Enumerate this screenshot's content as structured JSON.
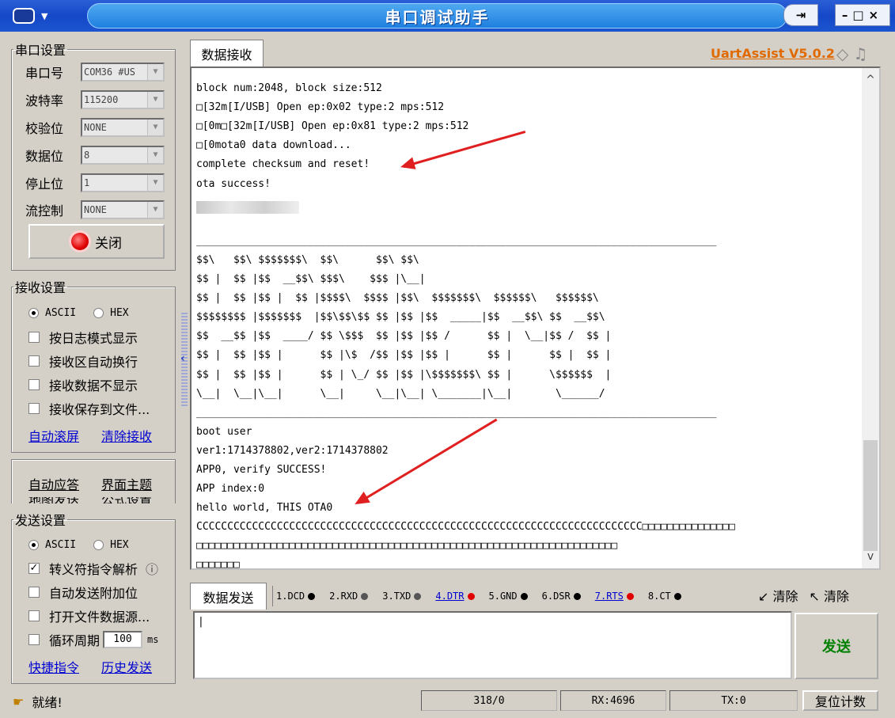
{
  "window": {
    "title": "串口调试助手"
  },
  "serial": {
    "legend": "串口设置",
    "port_label": "串口号",
    "port_value": "COM36 #US",
    "baud_label": "波特率",
    "baud_value": "115200",
    "parity_label": "校验位",
    "parity_value": "NONE",
    "databits_label": "数据位",
    "databits_value": "8",
    "stopbits_label": "停止位",
    "stopbits_value": "1",
    "flow_label": "流控制",
    "flow_value": "NONE",
    "close_label": "关闭"
  },
  "receive_settings": {
    "legend": "接收设置",
    "ascii": "ASCII",
    "hex": "HEX",
    "log_mode": "按日志模式显示",
    "auto_wrap": "接收区自动换行",
    "hide_data": "接收数据不显示",
    "save_file": "接收保存到文件...",
    "auto_scroll": "自动滚屏",
    "clear_recv": "清除接收"
  },
  "extra": {
    "auto_reply": "自动应答",
    "ui_theme": "界面主题",
    "cut1": "地图发送",
    "cut2": "公式设置"
  },
  "send_settings": {
    "legend": "发送设置",
    "ascii": "ASCII",
    "hex": "HEX",
    "escape": "转义符指令解析",
    "info": "ⓘ",
    "append": "自动发送附加位",
    "open_file": "打开文件数据源...",
    "cycle": "循环周期",
    "cycle_value": "100",
    "cycle_unit": "ms",
    "shortcut": "快捷指令",
    "history": "历史发送"
  },
  "receive": {
    "tab": "数据接收",
    "brand": "UartAssist V5.0.2",
    "lines": [
      "▔▔ ▔  ▔▔ ▔▔  ▔ ▔",
      "block num:2048, block size:512",
      "□[32m[I/USB] Open ep:0x02 type:2 mps:512",
      "□[0m□[32m[I/USB] Open ep:0x81 type:2 mps:512",
      "□[0mota0 data download...",
      "complete checksum and reset!",
      "ota success!",
      "",
      "",
      "____________________________________________________________________________________",
      "$$\\   $$\\ $$$$$$$\\  $$\\      $$\\ $$\\",
      "$$ |  $$ |$$  __$$\\ $$$\\    $$$ |\\__|",
      "$$ |  $$ |$$ |  $$ |$$$$\\  $$$$ |$$\\  $$$$$$$\\  $$$$$$\\   $$$$$$\\",
      "$$$$$$$$ |$$$$$$$  |$$\\$$\\$$ $$ |$$ |$$  _____|$$  __$$\\ $$  __$$\\",
      "$$  __$$ |$$  ____/ $$ \\$$$  $$ |$$ |$$ /      $$ |  \\__|$$ /  $$ |",
      "$$ |  $$ |$$ |      $$ |\\$  /$$ |$$ |$$ |      $$ |      $$ |  $$ |",
      "$$ |  $$ |$$ |      $$ | \\_/ $$ |$$ |\\$$$$$$$\\ $$ |      \\$$$$$$  |",
      "\\__|  \\__|\\__|      \\__|     \\__|\\__| \\_______|\\__|       \\______/",
      "____________________________________________________________________________________",
      "boot user",
      "ver1:1714378802,ver2:1714378802",
      "APP0, verify SUCCESS!",
      "APP index:0",
      "hello world, THIS OTA0",
      "CCCCCCCCCCCCCCCCCCCCCCCCCCCCCCCCCCCCCCCCCCCCCCCCCCCCCCCCCCCCCCCCCCCCCCCC□□□□□□□□□□□□□□□",
      "□□□□□□□□□□□□□□□□□□□□□□□□□□□□□□□□□□□□□□□□□□□□□□□□□□□□□□□□□□□□□□□□□□□□",
      "□□□□□□□"
    ]
  },
  "send": {
    "tab": "数据发送",
    "pins": [
      {
        "label": "1.DCD",
        "color": "#000000",
        "link": false
      },
      {
        "label": "2.RXD",
        "color": "#555555",
        "link": false
      },
      {
        "label": "3.TXD",
        "color": "#555555",
        "link": false
      },
      {
        "label": "4.DTR",
        "color": "#e00000",
        "link": true
      },
      {
        "label": "5.GND",
        "color": "#000000",
        "link": false
      },
      {
        "label": "6.DSR",
        "color": "#000000",
        "link": false
      },
      {
        "label": "7.RTS",
        "color": "#e00000",
        "link": true
      },
      {
        "label": "8.CT",
        "color": "#000000",
        "link": false
      }
    ],
    "clear1": "清除",
    "clear2": "清除",
    "send_label": "发送",
    "input_value": ""
  },
  "status": {
    "ready": "就绪!",
    "counter": "318/0",
    "rx": "RX:4696",
    "tx": "TX:0",
    "reset": "复位计数"
  },
  "colors": {
    "brand": "#e06a00",
    "link": "#0000d0",
    "send_green": "#008000",
    "annotation": "#e02020"
  }
}
